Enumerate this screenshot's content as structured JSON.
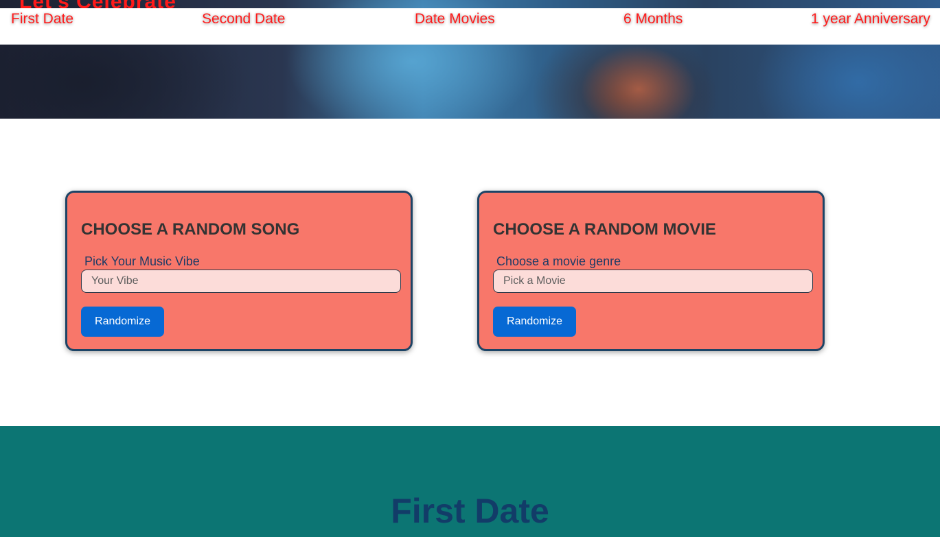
{
  "hero": {
    "title": "Let's Celebrate"
  },
  "nav": {
    "links": [
      {
        "label": "First Date"
      },
      {
        "label": "Second Date"
      },
      {
        "label": "Date Movies"
      },
      {
        "label": "6 Months"
      },
      {
        "label": "1 year Anniversary"
      }
    ],
    "link_color": "#ff1a1a"
  },
  "song_card": {
    "title": "CHOOSE A RANDOM SONG",
    "label": "Pick Your Music Vibe",
    "input_placeholder": "Your Vibe",
    "input_value": "",
    "button_label": "Randomize"
  },
  "movie_card": {
    "title": "CHOOSE A RANDOM MOVIE",
    "label": "Choose a movie genre",
    "input_placeholder": "Pick a Movie",
    "input_value": "",
    "button_label": "Randomize"
  },
  "section": {
    "title": "First Date"
  },
  "colors": {
    "card_bg": "#f8776a",
    "card_border": "#1d4466",
    "button_bg": "#0769d4",
    "teal_bg": "#0c7573",
    "section_title": "#123c68"
  }
}
